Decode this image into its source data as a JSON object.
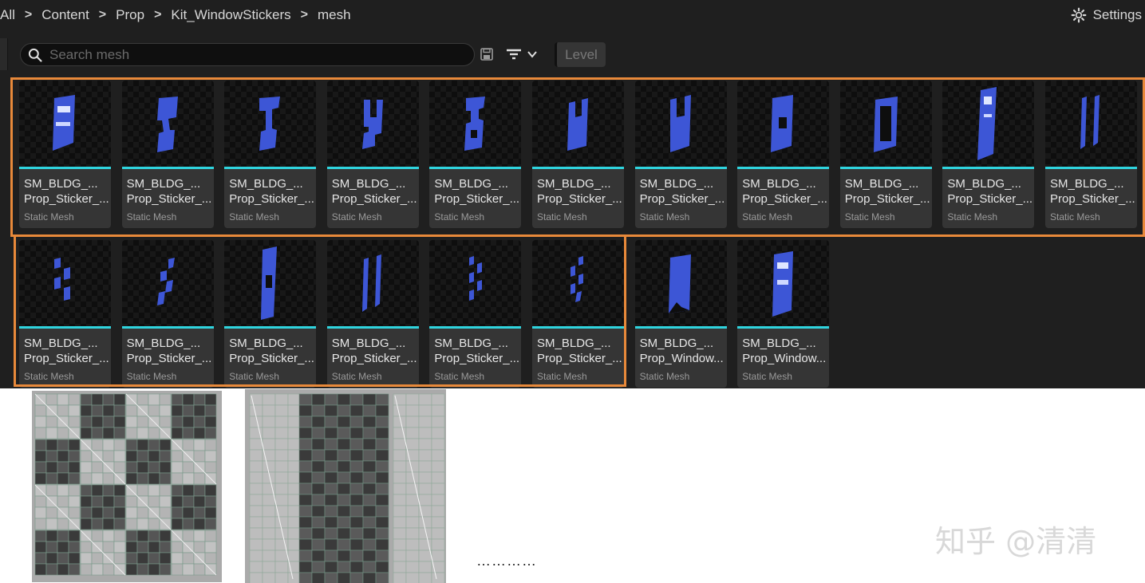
{
  "breadcrumb": {
    "items": [
      "All",
      "Content",
      "Prop",
      "Kit_WindowStickers",
      "mesh"
    ]
  },
  "settings": {
    "label": "Settings",
    "icon": "gear-icon"
  },
  "search": {
    "placeholder": "Search mesh",
    "value": ""
  },
  "toolbar": {
    "level_label": "Level",
    "save_icon": "save-icon",
    "filter_icon": "filter-icon"
  },
  "colors": {
    "panel_bg": "#1f1f1f",
    "tile_bg": "#353535",
    "accent": "#2fd4de",
    "selection": "#e8893a",
    "mesh_blue": "#3d56d6"
  },
  "assets": [
    {
      "name": "SM_BLDG_...\nProp_Sticker_...",
      "type": "Static Mesh",
      "selected": true
    },
    {
      "name": "SM_BLDG_...\nProp_Sticker_...",
      "type": "Static Mesh",
      "selected": true
    },
    {
      "name": "SM_BLDG_...\nProp_Sticker_...",
      "type": "Static Mesh",
      "selected": true
    },
    {
      "name": "SM_BLDG_...\nProp_Sticker_...",
      "type": "Static Mesh",
      "selected": true
    },
    {
      "name": "SM_BLDG_...\nProp_Sticker_...",
      "type": "Static Mesh",
      "selected": true
    },
    {
      "name": "SM_BLDG_...\nProp_Sticker_...",
      "type": "Static Mesh",
      "selected": true
    },
    {
      "name": "SM_BLDG_...\nProp_Sticker_...",
      "type": "Static Mesh",
      "selected": true
    },
    {
      "name": "SM_BLDG_...\nProp_Sticker_...",
      "type": "Static Mesh",
      "selected": true
    },
    {
      "name": "SM_BLDG_...\nProp_Sticker_...",
      "type": "Static Mesh",
      "selected": true
    },
    {
      "name": "SM_BLDG_...\nProp_Sticker_...",
      "type": "Static Mesh",
      "selected": true
    },
    {
      "name": "SM_BLDG_...\nProp_Sticker_...",
      "type": "Static Mesh",
      "selected": true
    },
    {
      "name": "SM_BLDG_...\nProp_Sticker_...",
      "type": "Static Mesh",
      "selected": true
    },
    {
      "name": "SM_BLDG_...\nProp_Sticker_...",
      "type": "Static Mesh",
      "selected": true
    },
    {
      "name": "SM_BLDG_...\nProp_Sticker_...",
      "type": "Static Mesh",
      "selected": true
    },
    {
      "name": "SM_BLDG_...\nProp_Sticker_...",
      "type": "Static Mesh",
      "selected": true
    },
    {
      "name": "SM_BLDG_...\nProp_Sticker_...",
      "type": "Static Mesh",
      "selected": true
    },
    {
      "name": "SM_BLDG_...\nProp_Sticker_...",
      "type": "Static Mesh",
      "selected": true
    },
    {
      "name": "SM_BLDG_...\nProp_Window...",
      "type": "Static Mesh",
      "selected": false
    },
    {
      "name": "SM_BLDG_...\nProp_Window...",
      "type": "Static Mesh",
      "selected": false
    }
  ],
  "footer": {
    "ellipsis": "…………",
    "watermark": "知乎 @清清"
  }
}
